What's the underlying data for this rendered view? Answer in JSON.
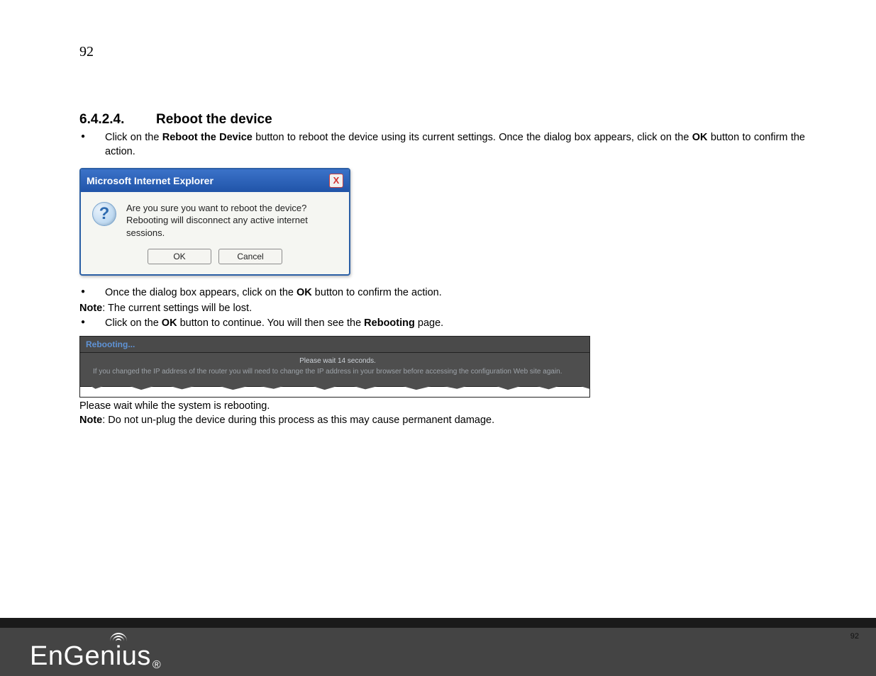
{
  "page": {
    "top_number": "92",
    "footer_number": "92"
  },
  "heading": {
    "number": "6.4.2.4.",
    "title": "Reboot the device"
  },
  "text": {
    "b1_pre": "Click on the ",
    "b1_bold": "Reboot the Device",
    "b1_mid": " button to reboot the device using its current settings. Once the dialog box appears, click on the ",
    "b1_bold2": "OK",
    "b1_post": " button to confirm the action.",
    "b2_pre": "Once the dialog box appears, click on the ",
    "b2_bold": "OK",
    "b2_post": " button to confirm the action.",
    "note1_label": "Note",
    "note1_text": ": The current settings will be lost.",
    "b3_pre": "Click on the ",
    "b3_bold": "OK",
    "b3_mid": " button to continue.  You will then see the ",
    "b3_bold2": "Rebooting",
    "b3_post": " page.",
    "wait_line": "Please wait while the system is rebooting.",
    "note2_label": "Note",
    "note2_text": ": Do not un-plug the device during this process as this may cause permanent damage."
  },
  "dialog": {
    "title": "Microsoft Internet Explorer",
    "close": "X",
    "icon": "?",
    "line1": "Are you sure you want to reboot the device?",
    "line2": "Rebooting will disconnect any active internet sessions.",
    "ok": "OK",
    "cancel": "Cancel"
  },
  "rebooting": {
    "header": "Rebooting...",
    "wait": "Please wait 14 seconds.",
    "note": "If you changed the IP address of the router you will need to change the IP address in your browser before accessing the configuration Web site again."
  },
  "logo": {
    "text_pre": "EnGen",
    "text_i": "i",
    "text_post": "us",
    "reg": "®"
  },
  "bullets": {
    "dot": "●"
  }
}
